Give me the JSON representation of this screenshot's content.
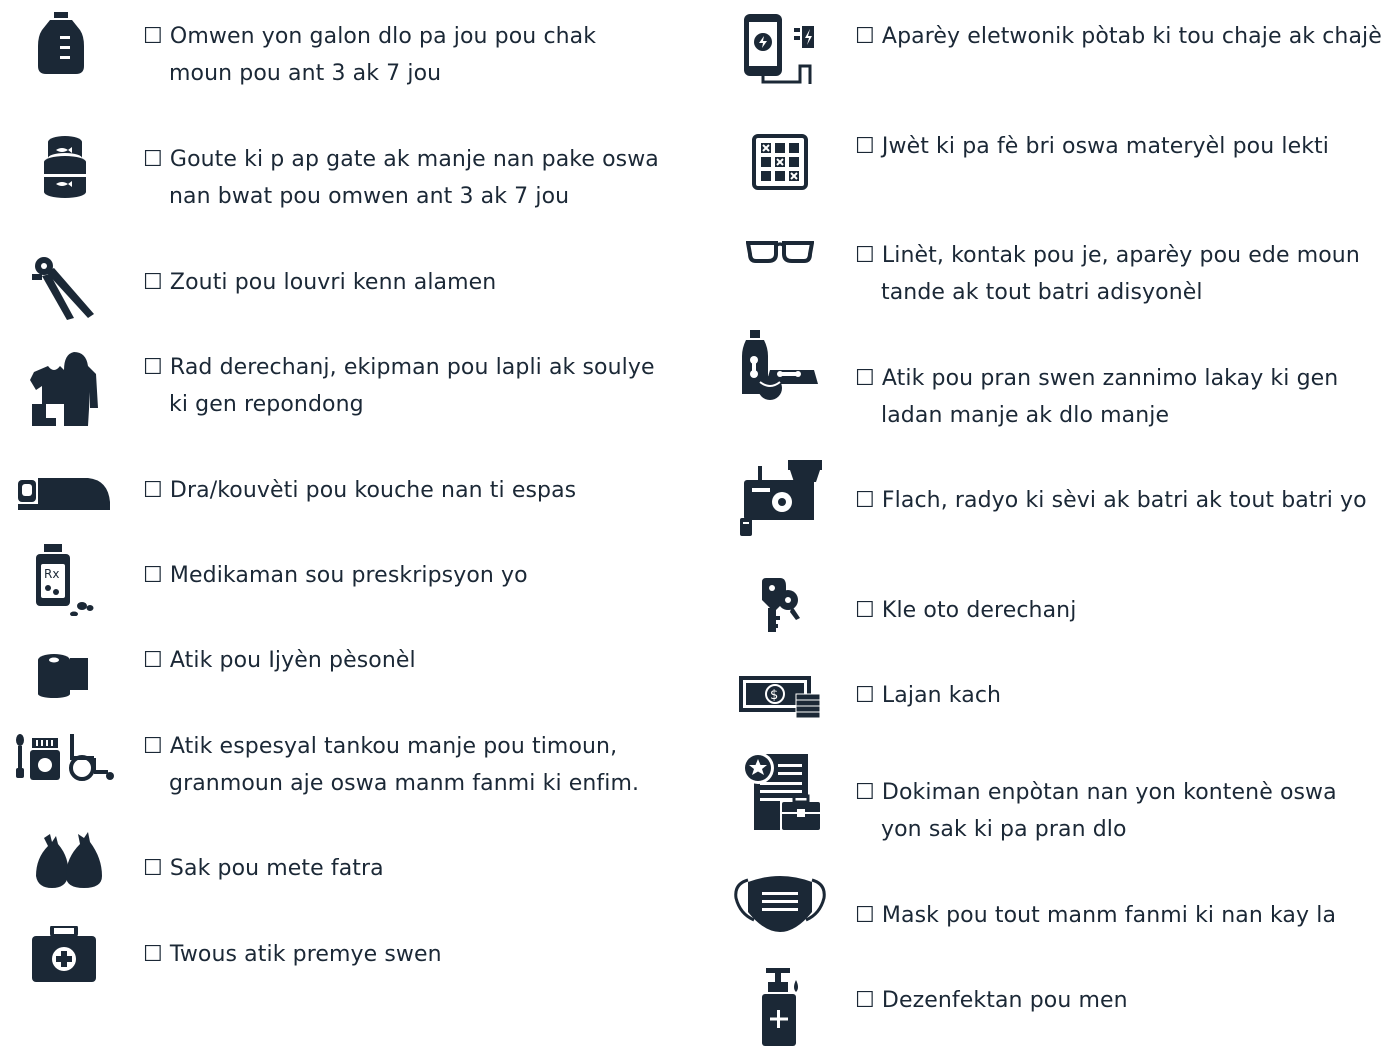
{
  "colors": {
    "ink": "#1b2836",
    "background": "#ffffff"
  },
  "checkbox": "☐",
  "left": [
    {
      "icon": "water-jug-icon",
      "lines": [
        "Omwen yon galon dlo pa jou pou chak",
        "moun pou ant 3 ak 7 jou"
      ]
    },
    {
      "icon": "canned-food-icon",
      "lines": [
        "Goute ki p ap gate ak manje nan pake oswa",
        "nan bwat pou omwen ant 3 ak 7 jou"
      ]
    },
    {
      "icon": "can-opener-icon",
      "lines": [
        "Zouti pou louvri kenn alamen"
      ]
    },
    {
      "icon": "rain-gear-icon",
      "lines": [
        "Rad derechanj, ekipman pou lapli ak soulye",
        "ki gen repondong"
      ]
    },
    {
      "icon": "sleeping-bag-icon",
      "lines": [
        "Dra/kouvèti pou kouche nan ti espas"
      ]
    },
    {
      "icon": "prescription-bottle-icon",
      "lines": [
        "Medikaman sou preskripsyon yo"
      ]
    },
    {
      "icon": "toilet-paper-icon",
      "lines": [
        "Atik pou Ijyèn pèsonèl"
      ]
    },
    {
      "icon": "baby-food-wheelchair-icon",
      "lines": [
        "Atik espesyal tankou manje pou timoun,",
        "granmoun aje oswa manm fanmi ki enfim."
      ]
    },
    {
      "icon": "trash-bags-icon",
      "lines": [
        "Sak pou mete fatra"
      ]
    },
    {
      "icon": "first-aid-kit-icon",
      "lines": [
        "Twous atik premye swen"
      ]
    }
  ],
  "right": [
    {
      "icon": "phone-charger-icon",
      "lines": [
        "Aparèy eletwonik pòtab ki tou chaje ak chajè"
      ]
    },
    {
      "icon": "board-game-icon",
      "lines": [
        "Jwèt ki pa fè bri oswa materyèl pou lekti"
      ]
    },
    {
      "icon": "glasses-icon",
      "lines": [
        "Linèt, kontak pou je, aparèy pou ede moun",
        "tande ak tout batri adisyonèl"
      ]
    },
    {
      "icon": "pet-supplies-icon",
      "lines": [
        "Atik pou pran swen zannimo lakay ki gen",
        "ladan manje ak dlo manje"
      ]
    },
    {
      "icon": "flashlight-radio-icon",
      "lines": [
        "Flach, radyo ki sèvi ak batri ak tout batri yo"
      ]
    },
    {
      "icon": "car-keys-icon",
      "lines": [
        "Kle oto derechanj"
      ]
    },
    {
      "icon": "cash-icon",
      "lines": [
        "Lajan kach"
      ]
    },
    {
      "icon": "documents-briefcase-icon",
      "lines": [
        "Dokiman enpòtan nan yon kontenè oswa",
        "yon sak ki pa pran dlo"
      ]
    },
    {
      "icon": "face-mask-icon",
      "lines": [
        "Mask pou tout manm fanmi ki nan kay la"
      ]
    },
    {
      "icon": "hand-sanitizer-icon",
      "lines": [
        "Dezenfektan pou men"
      ]
    }
  ]
}
